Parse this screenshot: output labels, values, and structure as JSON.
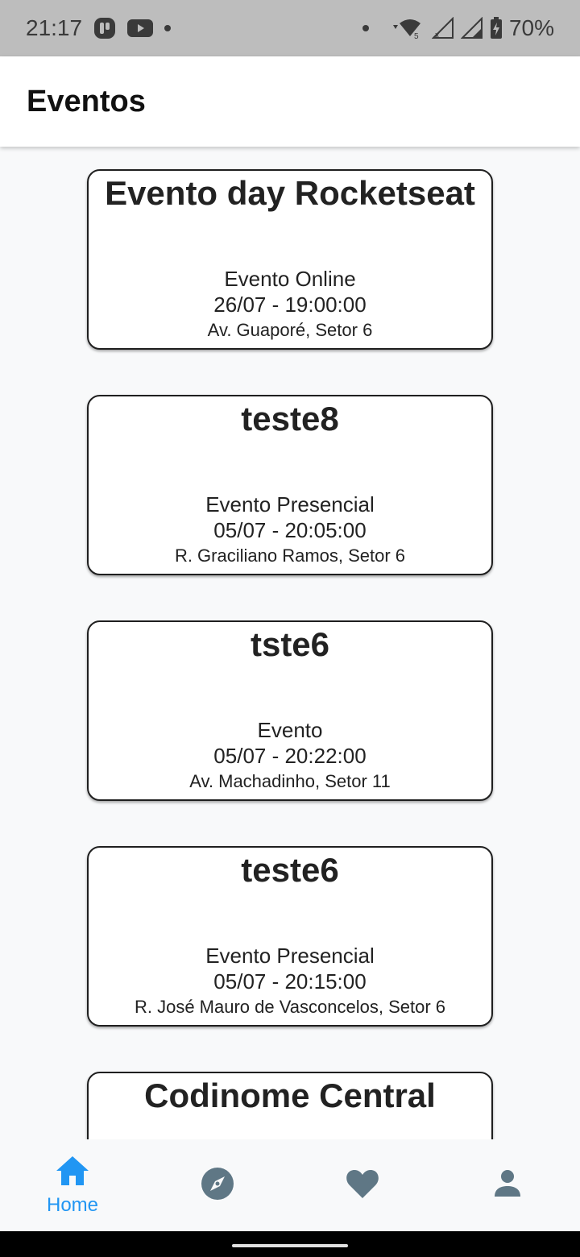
{
  "status_bar": {
    "time": "21:17",
    "battery_percent": "70%",
    "left_icons": [
      "app-icon",
      "youtube-icon",
      "notification-dot-icon"
    ],
    "right_icons": [
      "notification-dot-icon",
      "wifi-icon",
      "signal-icon",
      "signal-icon",
      "battery-icon"
    ]
  },
  "app_bar": {
    "title": "Eventos"
  },
  "events": [
    {
      "title": "Evento day Rocketseat",
      "type": "Evento Online",
      "datetime": "26/07 - 19:00:00",
      "address": "Av. Guaporé,  Setor 6"
    },
    {
      "title": "teste8",
      "type": "Evento Presencial",
      "datetime": "05/07 - 20:05:00",
      "address": "R. Graciliano Ramos,  Setor 6"
    },
    {
      "title": "tste6",
      "type": "Evento",
      "datetime": "05/07 - 20:22:00",
      "address": "Av. Machadinho,  Setor 11"
    },
    {
      "title": "teste6",
      "type": "Evento Presencial",
      "datetime": "05/07 - 20:15:00",
      "address": "R. José Mauro de Vasconcelos,  Setor 6"
    },
    {
      "title": "Codinome Central"
    }
  ],
  "bottom_nav": {
    "items": [
      {
        "icon": "home-icon",
        "label": "Home",
        "active": true
      },
      {
        "icon": "compass-icon",
        "label": "",
        "active": false
      },
      {
        "icon": "heart-icon",
        "label": "",
        "active": false
      },
      {
        "icon": "person-icon",
        "label": "",
        "active": false
      }
    ]
  },
  "colors": {
    "active": "#2196f3",
    "inactive": "#5f7785"
  }
}
